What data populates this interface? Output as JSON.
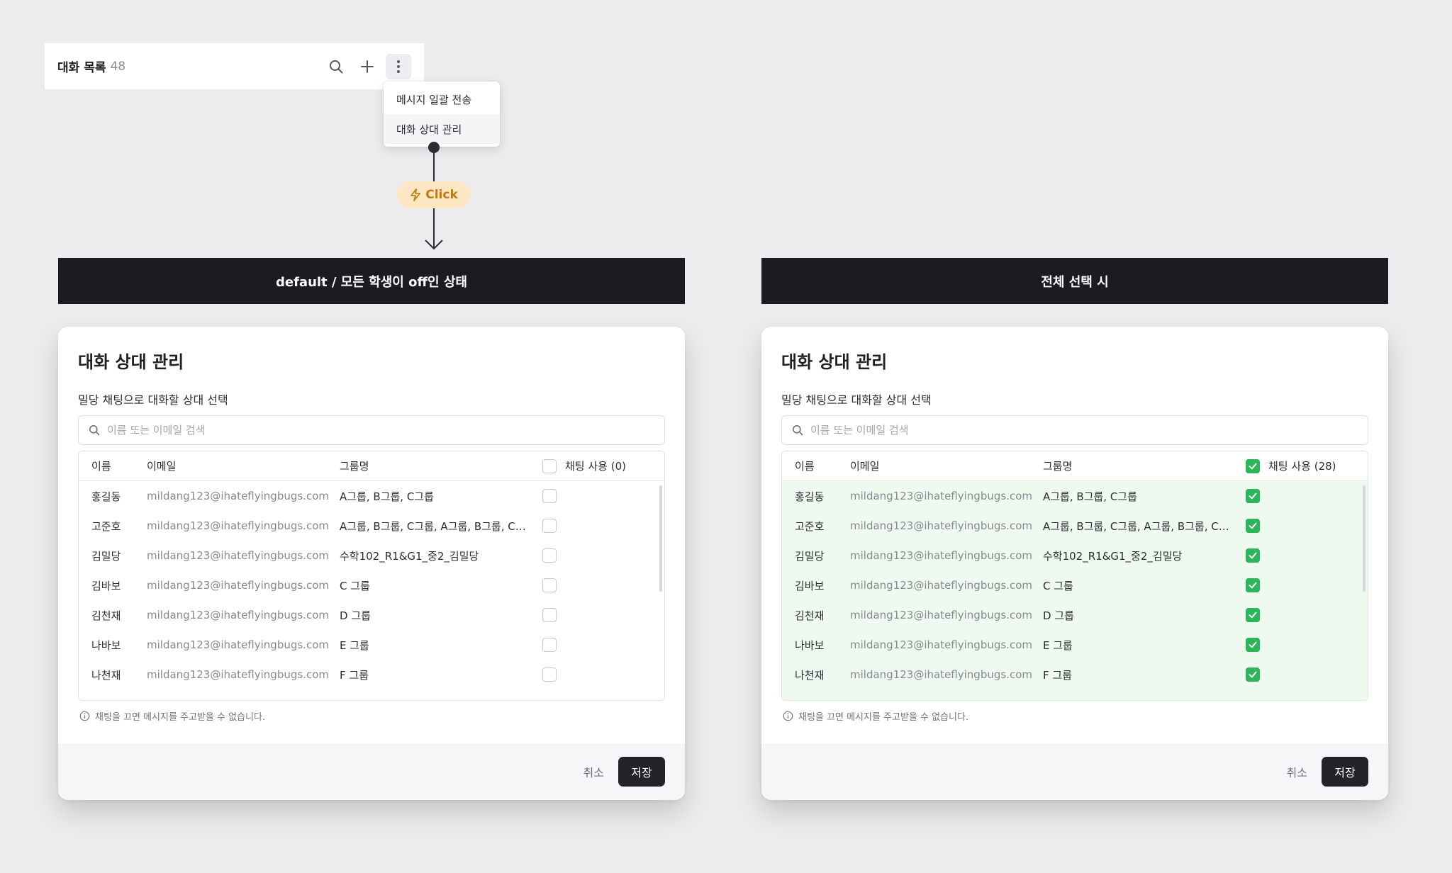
{
  "list_header": {
    "title": "대화 목록",
    "count": "48",
    "icons": [
      "search-icon",
      "plus-icon",
      "more-vertical-icon"
    ]
  },
  "menu": {
    "items": [
      {
        "label": "메시지 일괄 전송"
      },
      {
        "label": "대화 상대 관리"
      }
    ]
  },
  "click_badge": {
    "label": "Click",
    "icon": "lightning-icon"
  },
  "sections": {
    "left": "default / 모든 학생이 off인 상태",
    "right": "전체 선택 시"
  },
  "modal": {
    "title": "대화 상대 관리",
    "subtitle": "밀당 채팅으로 대화할 상대 선택",
    "search_placeholder": "이름 또는 이메일 검색",
    "columns": {
      "name": "이름",
      "email": "이메일",
      "group": "그룹명"
    },
    "notice": "채팅을 끄면 메시지를 주고받을 수 없습니다.",
    "cancel_label": "취소",
    "save_label": "저장"
  },
  "left": {
    "chat_header": "채팅 사용 (0)",
    "all_checked": false
  },
  "right": {
    "chat_header": "채팅 사용 (28)",
    "all_checked": true
  },
  "rows": [
    {
      "name": "홍길동",
      "email": "mildang123@ihateflyingbugs.com",
      "group": "A그룹, B그룹, C그룹"
    },
    {
      "name": "고준호",
      "email": "mildang123@ihateflyingbugs.com",
      "group": "A그룹, B그룹, C그룹, A그룹, B그룹, C그룹"
    },
    {
      "name": "김밀당",
      "email": "mildang123@ihateflyingbugs.com",
      "group": "수학102_R1&G1_중2_김밀당"
    },
    {
      "name": "김바보",
      "email": "mildang123@ihateflyingbugs.com",
      "group": "C 그룹"
    },
    {
      "name": "김천재",
      "email": "mildang123@ihateflyingbugs.com",
      "group": "D 그룹"
    },
    {
      "name": "나바보",
      "email": "mildang123@ihateflyingbugs.com",
      "group": "E 그룹"
    },
    {
      "name": "나천재",
      "email": "mildang123@ihateflyingbugs.com",
      "group": "F 그룹"
    }
  ],
  "colors": {
    "accent_green": "#2bb65a",
    "selected_row_bg": "#eef9f0",
    "badge_bg": "#fde6c2",
    "badge_text": "#c07a12",
    "dark": "#1b1c20"
  }
}
